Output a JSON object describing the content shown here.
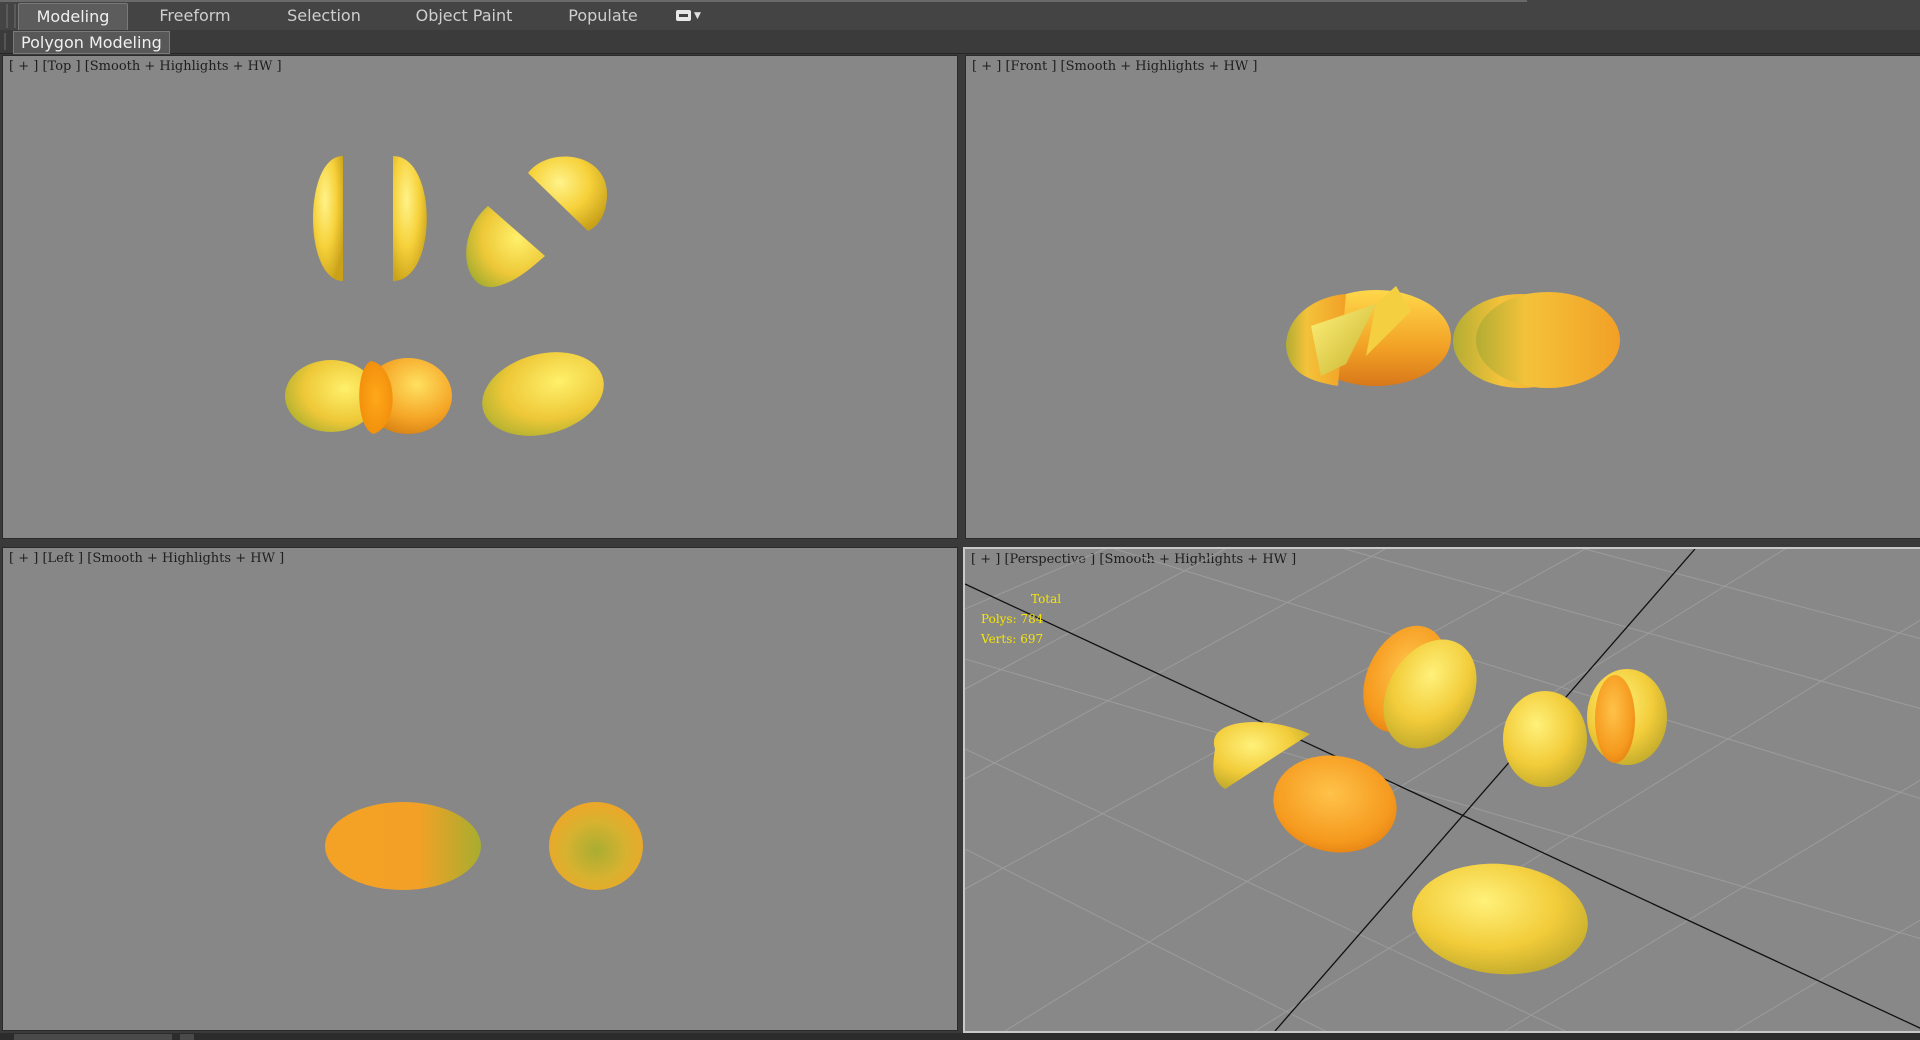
{
  "ribbon": {
    "tabs": [
      {
        "label": "Modeling",
        "active": true
      },
      {
        "label": "Freeform",
        "active": false
      },
      {
        "label": "Selection",
        "active": false
      },
      {
        "label": "Object Paint",
        "active": false
      },
      {
        "label": "Populate",
        "active": false
      }
    ],
    "panel_label": "Polygon Modeling"
  },
  "viewports": {
    "top": {
      "plus": "+",
      "view": "Top",
      "shading": "Smooth + Highlights + HW"
    },
    "front": {
      "plus": "+",
      "view": "Front",
      "shading": "Smooth + Highlights + HW"
    },
    "left": {
      "plus": "+",
      "view": "Left",
      "shading": "Smooth + Highlights + HW"
    },
    "perspective": {
      "plus": "+",
      "view": "Perspective",
      "shading": "Smooth + Highlights + HW"
    }
  },
  "stats": {
    "total_label": "Total",
    "polys": "Polys: 784",
    "verts": "Verts: 697"
  },
  "colors": {
    "viewport_bg": "#878787",
    "mango_yellow": "#f6d84a",
    "mango_orange": "#f29a1e",
    "mango_green": "#b5b43a",
    "stats_text": "#f4e40a"
  }
}
